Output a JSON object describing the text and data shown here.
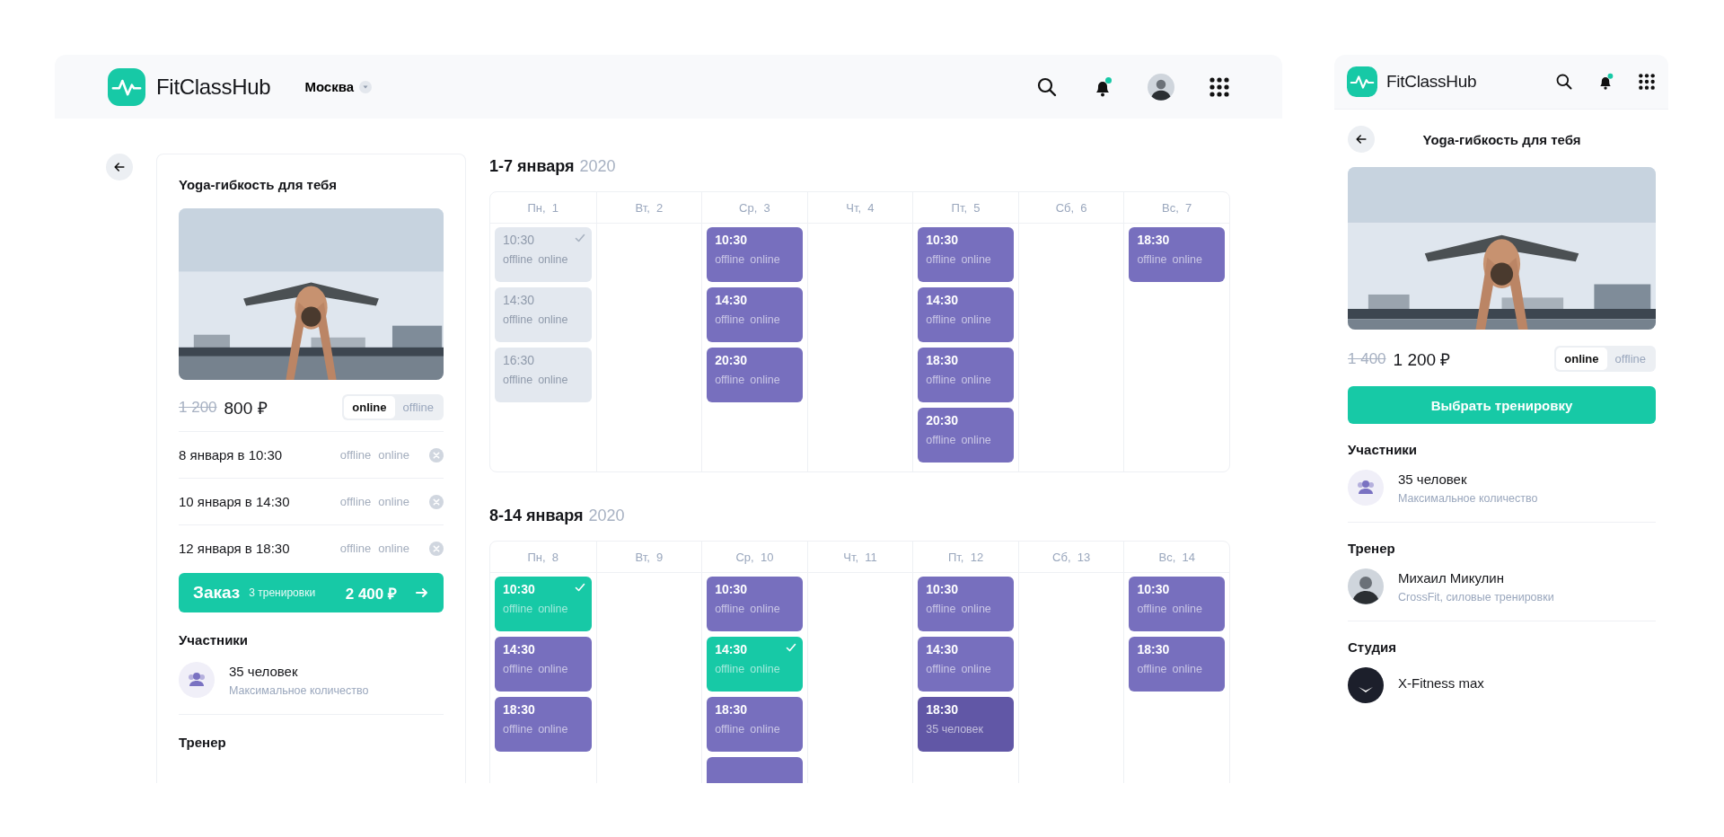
{
  "header": {
    "logo": "FitClassHub",
    "city": "Москва"
  },
  "left_card": {
    "title": "Yoga-гибкость для тебя",
    "old_price": "1 200",
    "price": "800 ₽",
    "modes": [
      {
        "label": "online",
        "selected": true
      },
      {
        "label": "offline",
        "selected": false
      }
    ],
    "bookings": [
      {
        "date": "8 января в 10:30",
        "modes": [
          "offline",
          "online"
        ]
      },
      {
        "date": "10 января в 14:30",
        "modes": [
          "offline",
          "online"
        ]
      },
      {
        "date": "12 января в 18:30",
        "modes": [
          "offline",
          "online"
        ]
      }
    ],
    "order": {
      "label": "Заказ",
      "count": "3 тренировки",
      "total": "2 400 ₽"
    },
    "participants": {
      "heading": "Участники",
      "value": "35 человек",
      "caption": "Максимальное количество"
    },
    "trainer_heading": "Тренер"
  },
  "weeks": [
    {
      "range": "1-7 января",
      "year": "2020",
      "days": [
        {
          "label": "Пн,  1",
          "slots": [
            {
              "time": "10:30",
              "kind": "past",
              "checked": true,
              "labels": [
                "offline",
                "online"
              ]
            },
            {
              "time": "14:30",
              "kind": "past",
              "checked": false,
              "labels": [
                "offline",
                "online"
              ]
            },
            {
              "time": "16:30",
              "kind": "past",
              "checked": false,
              "labels": [
                "offline",
                "online"
              ]
            }
          ]
        },
        {
          "label": "Вт,  2"
        },
        {
          "label": "Ср,  3",
          "slots": [
            {
              "time": "10:30",
              "kind": "open",
              "checked": false,
              "labels": [
                "offline",
                "online"
              ]
            },
            {
              "time": "14:30",
              "kind": "open",
              "checked": false,
              "labels": [
                "offline",
                "online"
              ]
            },
            {
              "time": "20:30",
              "kind": "open",
              "checked": false,
              "labels": [
                "offline",
                "online"
              ]
            }
          ]
        },
        {
          "label": "Чт,  4"
        },
        {
          "label": "Пт,  5",
          "slots": [
            {
              "time": "10:30",
              "kind": "open",
              "checked": false,
              "labels": [
                "offline",
                "online"
              ]
            },
            {
              "time": "14:30",
              "kind": "open",
              "checked": false,
              "labels": [
                "offline",
                "online"
              ]
            },
            {
              "time": "18:30",
              "kind": "open",
              "checked": false,
              "labels": [
                "offline",
                "online"
              ]
            },
            {
              "time": "20:30",
              "kind": "open",
              "checked": false,
              "labels": [
                "offline",
                "online"
              ]
            }
          ]
        },
        {
          "label": "Сб,  6"
        },
        {
          "label": "Вс,  7",
          "slots": [
            {
              "time": "18:30",
              "kind": "open",
              "checked": false,
              "labels": [
                "offline",
                "online"
              ]
            }
          ]
        }
      ]
    },
    {
      "range": "8-14 января",
      "year": "2020",
      "days": [
        {
          "label": "Пн,  8",
          "slots": [
            {
              "time": "10:30",
              "kind": "chosen",
              "checked": true,
              "labels": [
                "offline",
                "online"
              ]
            },
            {
              "time": "14:30",
              "kind": "open",
              "checked": false,
              "labels": [
                "offline",
                "online"
              ]
            },
            {
              "time": "18:30",
              "kind": "open",
              "checked": false,
              "labels": [
                "offline",
                "online"
              ]
            }
          ]
        },
        {
          "label": "Вт,  9"
        },
        {
          "label": "Ср,  10",
          "slots": [
            {
              "time": "10:30",
              "kind": "open",
              "checked": false,
              "labels": [
                "offline",
                "online"
              ]
            },
            {
              "time": "14:30",
              "kind": "chosen",
              "checked": true,
              "labels": [
                "offline",
                "online"
              ]
            },
            {
              "time": "18:30",
              "kind": "open",
              "checked": false,
              "labels": [
                "offline",
                "online"
              ]
            },
            {
              "kind": "open",
              "checked": false
            }
          ]
        },
        {
          "label": "Чт,  11"
        },
        {
          "label": "Пт,  12",
          "slots": [
            {
              "time": "10:30",
              "kind": "open",
              "checked": false,
              "labels": [
                "offline",
                "online"
              ]
            },
            {
              "time": "14:30",
              "kind": "open",
              "checked": false,
              "labels": [
                "offline",
                "online"
              ]
            },
            {
              "time": "18:30",
              "kind": "full",
              "checked": false,
              "labels": [
                "35 человек"
              ]
            }
          ]
        },
        {
          "label": "Сб,  13"
        },
        {
          "label": "Вс,  14",
          "slots": [
            {
              "time": "10:30",
              "kind": "open",
              "checked": false,
              "labels": [
                "offline",
                "online"
              ]
            },
            {
              "time": "18:30",
              "kind": "open",
              "checked": false,
              "labels": [
                "offline",
                "online"
              ]
            }
          ]
        }
      ]
    }
  ],
  "mobile": {
    "logo": "FitClassHub",
    "title": "Yoga-гибкость для тебя",
    "old_price": "1 400",
    "price": "1 200 ₽",
    "modes": [
      {
        "label": "online",
        "selected": true
      },
      {
        "label": "offline",
        "selected": false
      }
    ],
    "button": "Выбрать тренировку",
    "participants": {
      "heading": "Участники",
      "value": "35 человек",
      "caption": "Максимальное количество"
    },
    "trainer": {
      "heading": "Тренер",
      "name": "Михаил Микулин",
      "caption": "CrossFit, силовые тренировки"
    },
    "studio": {
      "heading": "Студия",
      "name": "X-Fitness max"
    }
  }
}
